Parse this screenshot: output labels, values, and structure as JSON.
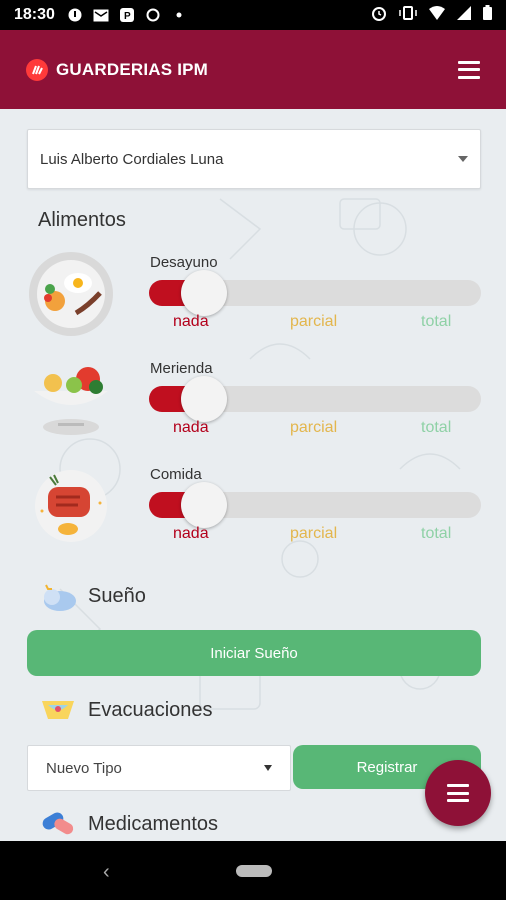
{
  "status_bar": {
    "time": "18:30",
    "icons": [
      "notification-icon",
      "mail-icon",
      "p-icon",
      "chat-icon",
      "dot-icon",
      "alarm-icon",
      "vibrate-icon",
      "wifi-icon",
      "signal-icon",
      "battery-icon"
    ]
  },
  "app_bar": {
    "title": "GUARDERIAS IPM",
    "brand_color": "#8e1137"
  },
  "child_select": {
    "value": "Luis Alberto Cordiales Luna"
  },
  "alimentos": {
    "title": "Alimentos",
    "levels": {
      "nada": "nada",
      "parcial": "parcial",
      "total": "total"
    },
    "meals": [
      {
        "label": "Desayuno",
        "icon": "breakfast-icon",
        "level": 0
      },
      {
        "label": "Merienda",
        "icon": "snack-icon",
        "level": 0
      },
      {
        "label": "Comida",
        "icon": "lunch-icon",
        "level": 0
      }
    ]
  },
  "sueno": {
    "title": "Sueño",
    "button": "Iniciar Sueño"
  },
  "evacuaciones": {
    "title": "Evacuaciones",
    "select_value": "Nuevo Tipo",
    "button": "Registrar"
  },
  "medicamentos": {
    "title": "Medicamentos"
  },
  "colors": {
    "primary": "#8e1137",
    "success": "#58b776",
    "slider_fill": "#c00f1f"
  }
}
